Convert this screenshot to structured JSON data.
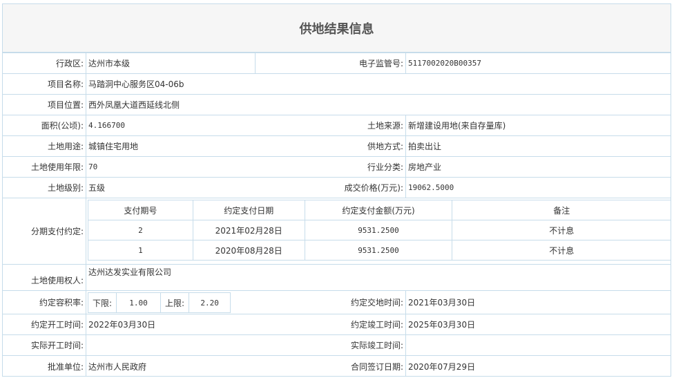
{
  "title": "供地结果信息",
  "fields": {
    "admin_region_label": "行政区:",
    "admin_region_value": "达州市本级",
    "e_supervision_label": "电子监管号:",
    "e_supervision_value": "5117002020B00357",
    "project_name_label": "项目名称:",
    "project_name_value": "马踏洞中心服务区04-06b",
    "project_location_label": "项目位置:",
    "project_location_value": "西外凤凰大道西延线北侧",
    "area_label": "面积(公顷):",
    "area_value": "4.166700",
    "land_source_label": "土地来源:",
    "land_source_value": "新增建设用地(来自存量库)",
    "land_use_label": "土地用途:",
    "land_use_value": "城镇住宅用地",
    "supply_method_label": "供地方式:",
    "supply_method_value": "拍卖出让",
    "use_years_label": "土地使用年限:",
    "use_years_value": "70",
    "industry_label": "行业分类:",
    "industry_value": "房地产业",
    "land_grade_label": "土地级别:",
    "land_grade_value": "五级",
    "price_label": "成交价格(万元):",
    "price_value": "19062.5000",
    "installment_label": "分期支付约定:",
    "land_user_label": "土地使用权人:",
    "land_user_value": "达州达发实业有限公司",
    "far_label": "约定容积率:",
    "far_lower_label": "下限:",
    "far_lower_value": "1.00",
    "far_upper_label": "上限:",
    "far_upper_value": "2.20",
    "delivery_label": "约定交地时间:",
    "delivery_value": "2021年03月30日",
    "start_label": "约定开工时间:",
    "start_value": "2022年03月30日",
    "completion_label": "约定竣工时间:",
    "completion_value": "2025年03月30日",
    "actual_start_label": "实际开工时间:",
    "actual_start_value": "",
    "actual_completion_label": "实际竣工时间:",
    "actual_completion_value": "",
    "approval_label": "批准单位:",
    "approval_value": "达州市人民政府",
    "contract_date_label": "合同签订日期:",
    "contract_date_value": "2020年07月29日"
  },
  "installments": {
    "headers": [
      "支付期号",
      "约定支付日期",
      "约定支付金额(万元)",
      "备注"
    ],
    "rows": [
      {
        "period": "2",
        "date": "2021年02月28日",
        "amount": "9531.2500",
        "note": "不计息"
      },
      {
        "period": "1",
        "date": "2020年08月28日",
        "amount": "9531.2500",
        "note": "不计息"
      }
    ]
  },
  "colors": {
    "border": "#c6dcea",
    "header_bg": "#f6f6f6",
    "text": "#333333"
  }
}
